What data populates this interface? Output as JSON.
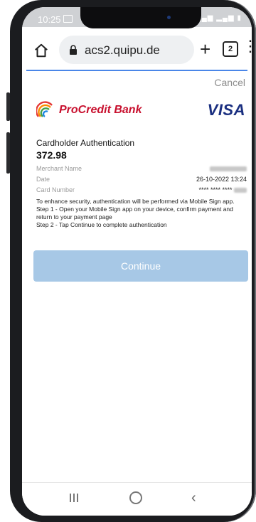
{
  "status": {
    "time": "10:25"
  },
  "browser": {
    "url": "acs2.quipu.de",
    "tab_count": "2"
  },
  "page": {
    "cancel_label": "Cancel",
    "bank_name": "ProCredit Bank",
    "card_brand": "VISA",
    "title": "Cardholder Authentication",
    "amount": "372.98",
    "merchant_label": "Merchant Name",
    "date_label": "Date",
    "date_value": "26-10-2022 13:24",
    "card_label": "Card Number",
    "card_value": "**** **** ****",
    "info_line1": "To enhance security, authentication will be performed via Mobile Sign app.",
    "info_line2": "Step 1 - Open your Mobile Sign app on your device, confirm payment and return to your payment page",
    "info_line3": "Step 2 - Tap Continue to complete authentication",
    "continue_label": "Continue"
  },
  "colors": {
    "bank_red": "#c8102e",
    "visa_blue": "#1a2f80",
    "button_disabled": "#a7c8e6",
    "progress_blue": "#4a86e8"
  }
}
